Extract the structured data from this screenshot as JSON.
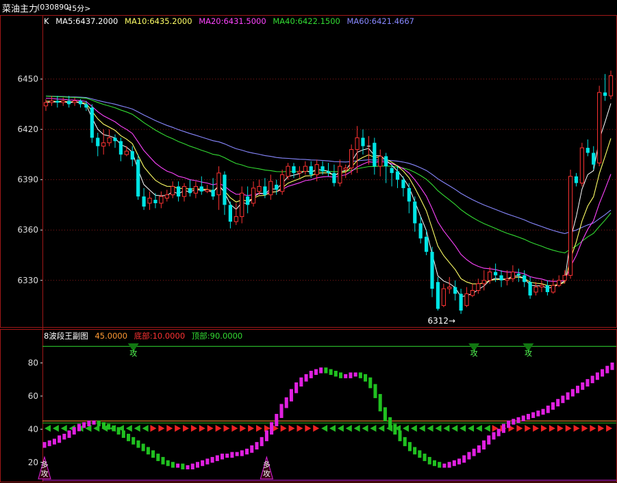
{
  "title": {
    "name": "菜油主力",
    "code": "(030890)",
    "period": "<5分>"
  },
  "colors": {
    "k": "#ffffff",
    "ma5": "#ffffff",
    "ma10": "#ffff66",
    "ma20": "#ff44ff",
    "ma40": "#33dd33",
    "ma60": "#8888ff",
    "up": "#ff3333",
    "down": "#00e5e5",
    "frame": "#a01818",
    "grid": "#8a1a1a",
    "sub_title": "#ffffff",
    "sub_level": "#ff9933",
    "sub_bottom": "#ff3333",
    "sub_top": "#33dd33",
    "magenta": "#e020e0",
    "green": "#20c020"
  },
  "main_legend": {
    "k": "K",
    "ma5": "MA5:6437.2000",
    "ma10": "MA10:6435.2000",
    "ma20": "MA20:6431.5000",
    "ma40": "MA40:6422.1500",
    "ma60": "MA60:6421.4667"
  },
  "sub_legend": {
    "name": "8波段王副图",
    "level": "45.0000",
    "bottom": "底部:10.0000",
    "top": "顶部:90.0000"
  },
  "annotations": {
    "low": "6312",
    "arrow": "→",
    "attack": "攻",
    "long": "多"
  },
  "chart_data": [
    {
      "type": "candlestick",
      "name": "K",
      "y_ticks": [
        "6450",
        "6420",
        "6390",
        "6360",
        "6330"
      ],
      "ylim": [
        6303,
        6480
      ],
      "candles": [
        [
          6434,
          6436,
          6431,
          6438
        ],
        [
          6436,
          6437,
          6434,
          6440
        ],
        [
          6437,
          6436,
          6433,
          6440
        ],
        [
          6436,
          6437,
          6434,
          6439
        ],
        [
          6437,
          6435,
          6433,
          6440
        ],
        [
          6436,
          6437,
          6434,
          6439
        ],
        [
          6437,
          6435,
          6433,
          6438
        ],
        [
          6435,
          6433,
          6431,
          6437
        ],
        [
          6433,
          6415,
          6412,
          6435
        ],
        [
          6415,
          6410,
          6404,
          6418
        ],
        [
          6410,
          6412,
          6405,
          6420
        ],
        [
          6412,
          6415,
          6410,
          6420
        ],
        [
          6415,
          6413,
          6409,
          6417
        ],
        [
          6413,
          6405,
          6401,
          6415
        ],
        [
          6405,
          6407,
          6404,
          6410
        ],
        [
          6407,
          6402,
          6398,
          6410
        ],
        [
          6402,
          6380,
          6378,
          6405
        ],
        [
          6380,
          6374,
          6372,
          6385
        ],
        [
          6376,
          6379,
          6372,
          6383
        ],
        [
          6378,
          6376,
          6373,
          6382
        ],
        [
          6376,
          6380,
          6373,
          6383
        ],
        [
          6379,
          6381,
          6377,
          6384
        ],
        [
          6381,
          6386,
          6379,
          6389
        ],
        [
          6386,
          6380,
          6377,
          6389
        ],
        [
          6380,
          6386,
          6377,
          6388
        ],
        [
          6385,
          6382,
          6380,
          6390
        ],
        [
          6382,
          6386,
          6379,
          6389
        ],
        [
          6386,
          6383,
          6381,
          6392
        ],
        [
          6383,
          6384,
          6382,
          6387
        ],
        [
          6384,
          6380,
          6378,
          6391
        ],
        [
          6381,
          6394,
          6372,
          6398
        ],
        [
          6393,
          6375,
          6369,
          6395
        ],
        [
          6375,
          6365,
          6361,
          6377
        ],
        [
          6365,
          6368,
          6363,
          6376
        ],
        [
          6368,
          6382,
          6364,
          6386
        ],
        [
          6380,
          6375,
          6370,
          6386
        ],
        [
          6376,
          6385,
          6374,
          6389
        ],
        [
          6383,
          6386,
          6381,
          6390
        ],
        [
          6386,
          6381,
          6379,
          6391
        ],
        [
          6381,
          6389,
          6378,
          6393
        ],
        [
          6387,
          6384,
          6381,
          6390
        ],
        [
          6383,
          6393,
          6381,
          6396
        ],
        [
          6392,
          6398,
          6390,
          6400
        ],
        [
          6398,
          6394,
          6391,
          6400
        ],
        [
          6394,
          6395,
          6391,
          6398
        ],
        [
          6395,
          6398,
          6393,
          6401
        ],
        [
          6398,
          6393,
          6391,
          6401
        ],
        [
          6393,
          6399,
          6389,
          6402
        ],
        [
          6398,
          6395,
          6393,
          6401
        ],
        [
          6395,
          6394,
          6392,
          6400
        ],
        [
          6394,
          6388,
          6386,
          6399
        ],
        [
          6388,
          6398,
          6386,
          6402
        ],
        [
          6396,
          6397,
          6391,
          6399
        ],
        [
          6397,
          6408,
          6393,
          6411
        ],
        [
          6408,
          6415,
          6394,
          6422
        ],
        [
          6415,
          6410,
          6405,
          6420
        ],
        [
          6410,
          6410,
          6399,
          6416
        ],
        [
          6412,
          6398,
          6393,
          6415
        ],
        [
          6398,
          6404,
          6392,
          6408
        ],
        [
          6404,
          6398,
          6388,
          6406
        ],
        [
          6397,
          6394,
          6386,
          6399
        ],
        [
          6395,
          6390,
          6385,
          6398
        ],
        [
          6390,
          6385,
          6380,
          6392
        ],
        [
          6385,
          6377,
          6370,
          6388
        ],
        [
          6377,
          6364,
          6359,
          6380
        ],
        [
          6364,
          6355,
          6352,
          6368
        ],
        [
          6356,
          6347,
          6345,
          6360
        ],
        [
          6347,
          6325,
          6320,
          6350
        ],
        [
          6329,
          6313,
          6312,
          6332
        ],
        [
          6315,
          6325,
          6314,
          6328
        ],
        [
          6325,
          6326,
          6322,
          6332
        ],
        [
          6326,
          6322,
          6318,
          6330
        ],
        [
          6322,
          6312,
          6310,
          6325
        ],
        [
          6315,
          6322,
          6314,
          6326
        ],
        [
          6321,
          6324,
          6320,
          6328
        ],
        [
          6324,
          6328,
          6322,
          6331
        ],
        [
          6328,
          6330,
          6324,
          6336
        ],
        [
          6330,
          6335,
          6328,
          6338
        ],
        [
          6335,
          6333,
          6329,
          6340
        ],
        [
          6333,
          6330,
          6326,
          6336
        ],
        [
          6330,
          6331,
          6327,
          6336
        ],
        [
          6331,
          6335,
          6329,
          6339
        ],
        [
          6334,
          6333,
          6329,
          6337
        ],
        [
          6333,
          6329,
          6326,
          6336
        ],
        [
          6329,
          6321,
          6319,
          6332
        ],
        [
          6323,
          6326,
          6321,
          6329
        ],
        [
          6326,
          6327,
          6323,
          6330
        ],
        [
          6327,
          6323,
          6321,
          6330
        ],
        [
          6323,
          6327,
          6322,
          6331
        ],
        [
          6327,
          6330,
          6326,
          6333
        ],
        [
          6330,
          6333,
          6328,
          6336
        ],
        [
          6333,
          6392,
          6331,
          6396
        ],
        [
          6392,
          6388,
          6386,
          6394
        ],
        [
          6388,
          6409,
          6386,
          6412
        ],
        [
          6409,
          6406,
          6404,
          6414
        ],
        [
          6406,
          6399,
          6396,
          6410
        ],
        [
          6400,
          6442,
          6398,
          6446
        ],
        [
          6442,
          6440,
          6437,
          6453
        ],
        [
          6440,
          6452,
          6438,
          6455
        ]
      ]
    },
    {
      "type": "bar",
      "name": "8波段王副图",
      "y_ticks": [
        "80",
        "60",
        "40",
        "20"
      ],
      "ylim": [
        10,
        93
      ],
      "reference_lines": [
        45,
        90
      ],
      "values": [
        31,
        32,
        33,
        35,
        36,
        38,
        40,
        42,
        43,
        44,
        44,
        43,
        42,
        41,
        40,
        38,
        36,
        34,
        32,
        30,
        28,
        26,
        24,
        22,
        20,
        19,
        18,
        18,
        17,
        17,
        18,
        19,
        20,
        21,
        22,
        23,
        24,
        24,
        25,
        25,
        26,
        27,
        29,
        31,
        34,
        38,
        43,
        48,
        54,
        58,
        63,
        67,
        70,
        72,
        74,
        75,
        76,
        75,
        74,
        73,
        72,
        72,
        73,
        73,
        72,
        70,
        66,
        60,
        52,
        46,
        42,
        38,
        34,
        31,
        28,
        26,
        24,
        22,
        20,
        19,
        18,
        18,
        19,
        20,
        21,
        23,
        25,
        27,
        29,
        32,
        35,
        37,
        39,
        42,
        44,
        45,
        46,
        47,
        48,
        49,
        50,
        51,
        53,
        55,
        57,
        59,
        61,
        63,
        65,
        67,
        69,
        71,
        73,
        75,
        77,
        79
      ],
      "direction": [
        1,
        1,
        1,
        1,
        1,
        1,
        1,
        1,
        1,
        1,
        1,
        0,
        0,
        0,
        0,
        0,
        0,
        0,
        0,
        0,
        0,
        0,
        0,
        0,
        0,
        0,
        0,
        0,
        0,
        0,
        1,
        1,
        1,
        1,
        1,
        1,
        1,
        1,
        1,
        1,
        1,
        1,
        1,
        1,
        1,
        1,
        1,
        1,
        1,
        1,
        1,
        1,
        1,
        1,
        1,
        1,
        1,
        0,
        0,
        0,
        0,
        0,
        1,
        1,
        0,
        0,
        0,
        0,
        0,
        0,
        0,
        0,
        0,
        0,
        0,
        0,
        0,
        0,
        0,
        0,
        0,
        0,
        1,
        1,
        1,
        1,
        1,
        1,
        1,
        1,
        1,
        1,
        1,
        1,
        1,
        1,
        1,
        1,
        1,
        1,
        1,
        1,
        1,
        1,
        1,
        1,
        1,
        1,
        1,
        1,
        1,
        1,
        1,
        1,
        1,
        1
      ],
      "signals_sell_index": [
        18,
        87,
        98
      ],
      "signals_buy_index": [
        0,
        45,
        137
      ],
      "arrow_pattern": "green-left then red-right repeating per wave"
    }
  ]
}
